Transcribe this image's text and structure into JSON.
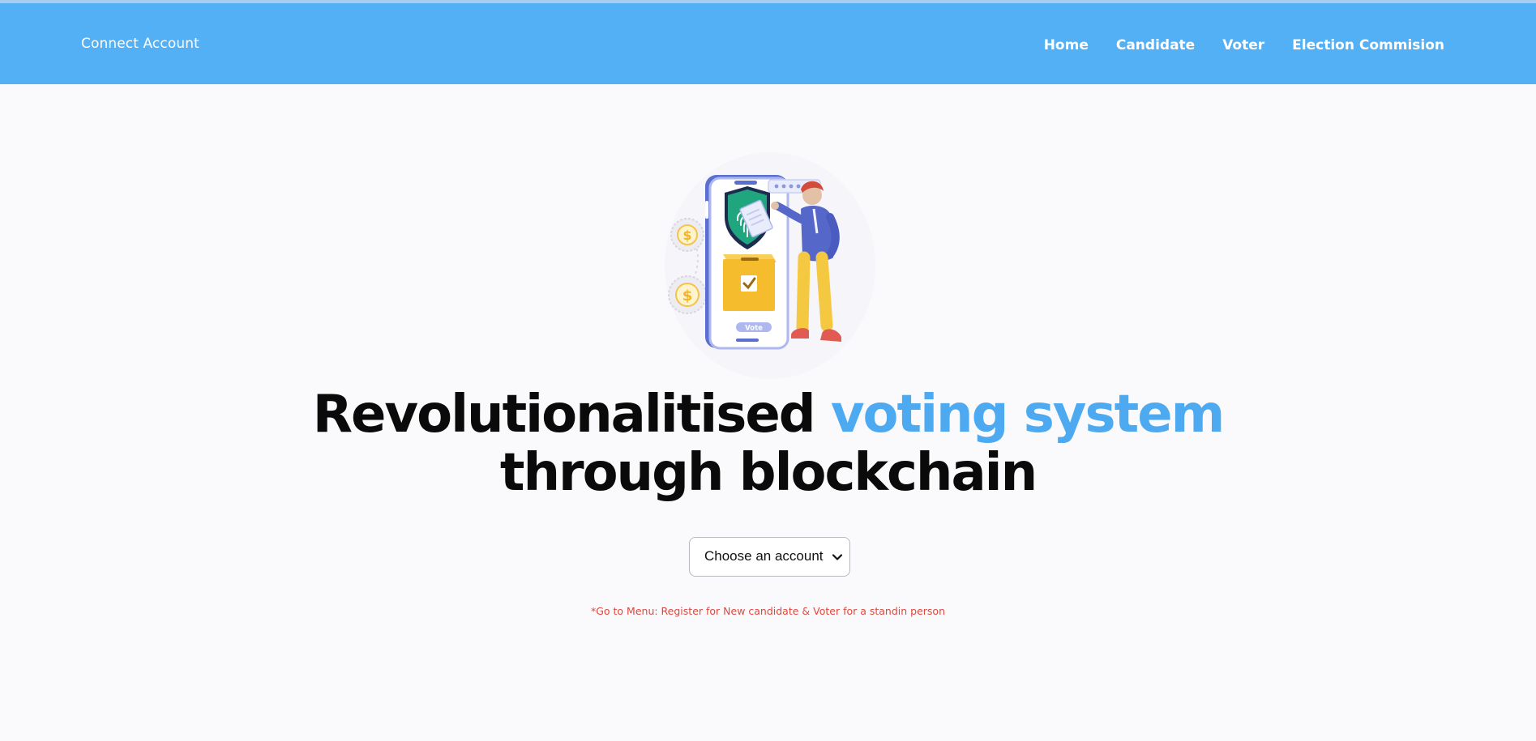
{
  "navbar": {
    "brand_label": "Connect Account",
    "links": [
      "Home",
      "Candidate",
      "Voter",
      "Election Commision"
    ]
  },
  "hero": {
    "illustration": {
      "icon": "voting-phone-illustration",
      "ballot_label": "Vote"
    },
    "headline_part1": "Revolutionalitised ",
    "headline_accent": "voting system",
    "headline_part2": "through blockchain"
  },
  "account_select": {
    "selected": "Choose an account"
  },
  "note": "*Go to Menu: Register for New candidate & Voter for a standin person",
  "colors": {
    "navbar": "#53b0f5",
    "accent": "#4eaaf0",
    "note": "#e0473c",
    "background": "#fafafc"
  }
}
